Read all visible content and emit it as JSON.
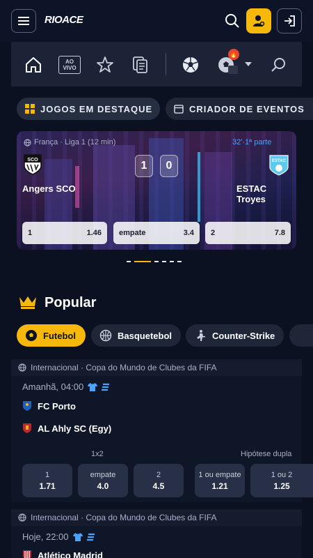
{
  "header": {
    "logo_text": "RIOACE",
    "icons": [
      "menu-icon",
      "search-icon",
      "user-icon",
      "login-icon"
    ],
    "accent": "#f5b80b"
  },
  "nav": {
    "items": [
      "home-icon",
      "live-icon",
      "star-icon",
      "betslip-icon",
      "football-icon",
      "sports-hot-icon",
      "chevron-down-icon",
      "search-icon"
    ],
    "live_label_line1": "AO",
    "live_label_line2": "VIVO"
  },
  "pills": {
    "featured": "JOGOS EM DESTAQUE",
    "creator": "CRIADOR DE EVENTOS"
  },
  "featured_match": {
    "league": "França · Liga 1 (12 min)",
    "time": "32'·1ª parte",
    "home_team": "Angers SCO",
    "away_team": "ESTAC Troyes",
    "home_score": "1",
    "away_score": "0",
    "home_crest_text": "SCO",
    "away_crest_text": "ESTAC",
    "odds": [
      {
        "label": "1",
        "value": "1.46"
      },
      {
        "label": "empate",
        "value": "3.4"
      },
      {
        "label": "2",
        "value": "7.8"
      }
    ],
    "carousel_pages": 6,
    "carousel_active": 2
  },
  "popular": {
    "title": "Popular",
    "sports": [
      {
        "label": "Futebol",
        "icon": "football-icon",
        "active": true
      },
      {
        "label": "Basquetebol",
        "icon": "basketball-icon",
        "active": false
      },
      {
        "label": "Counter-Strike",
        "icon": "counter-strike-icon",
        "active": false
      }
    ]
  },
  "matches": [
    {
      "league": "Internacional · Copa do Mundo de Clubes da FIFA",
      "time": "Amanhã, 04:00",
      "home": "FC Porto",
      "away": "AL Ahly SC (Egy)",
      "market1_label": "1x2",
      "market2_label": "Hipótese dupla",
      "odds": [
        {
          "label": "1",
          "value": "1.71"
        },
        {
          "label": "empate",
          "value": "4.0"
        },
        {
          "label": "2",
          "value": "4.5"
        },
        {
          "label": "1 ou empate",
          "value": "1.21"
        },
        {
          "label": "1 ou 2",
          "value": "1.25"
        }
      ]
    },
    {
      "league": "Internacional · Copa do Mundo de Clubes da FIFA",
      "time": "Hoje, 22:00",
      "home": "Atlético Madrid"
    }
  ]
}
